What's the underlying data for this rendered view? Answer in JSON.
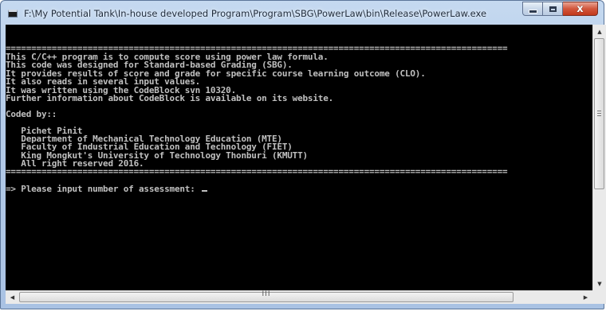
{
  "window": {
    "title": "F:\\My Potential Tank\\In-house developed Program\\Program\\SBG\\PowerLaw\\bin\\Release\\PowerLaw.exe",
    "icon": "console-app-icon",
    "controls": {
      "minimize": "minimize-icon",
      "maximize": "maximize-icon",
      "close_glyph": "x"
    }
  },
  "console": {
    "rule": "==================================================================================================",
    "intro": [
      "This C/C++ program is to compute score using power law formula.",
      "This code was designed for Standard-based Grading (SBG).",
      "It provides results of score and grade for specific course learning outcome (CLO).",
      "It also reads in several input values.",
      "It was written using the CodeBlock svn 10320.",
      "Further information about CodeBlock is available on its website."
    ],
    "coded_by": "Coded by::",
    "credits": [
      "   Pichet Pinit",
      "   Department of Mechanical Technology Education (MTE)",
      "   Faculty of Industrial Education and Technology (FIET)",
      "   King Mongkut's University of Technology Thonburi (KMUTT)",
      "   All right reserved 2016."
    ],
    "prompt": "=> Please input number of assessment: "
  },
  "scrollbar": {
    "up": "▲",
    "down": "▼",
    "left": "◀",
    "right": "▶",
    "grip": "III"
  },
  "colors": {
    "console_bg": "#000000",
    "console_fg": "#c0c0c0",
    "close_button": "#c8452a"
  }
}
